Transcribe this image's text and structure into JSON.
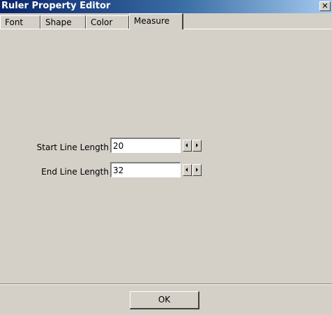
{
  "window": {
    "title": "Ruler Property Editor",
    "close_glyph": "✕"
  },
  "tabs": [
    {
      "label": "Font",
      "active": false
    },
    {
      "label": "Shape",
      "active": false
    },
    {
      "label": "Color",
      "active": false
    },
    {
      "label": "Measure",
      "active": true
    }
  ],
  "measure": {
    "start_line_length_label": "Start Line Length",
    "start_line_length_value": "20",
    "end_line_length_label": "End Line Length",
    "end_line_length_value": "32"
  },
  "footer": {
    "ok_label": "OK"
  },
  "icons": {
    "spin_decrement": "arrow-left-icon",
    "spin_increment": "arrow-right-icon",
    "close": "close-icon"
  },
  "colors": {
    "titlebar_start": "#0a246a",
    "titlebar_end": "#a6caf0",
    "face": "#d4d0c8"
  }
}
